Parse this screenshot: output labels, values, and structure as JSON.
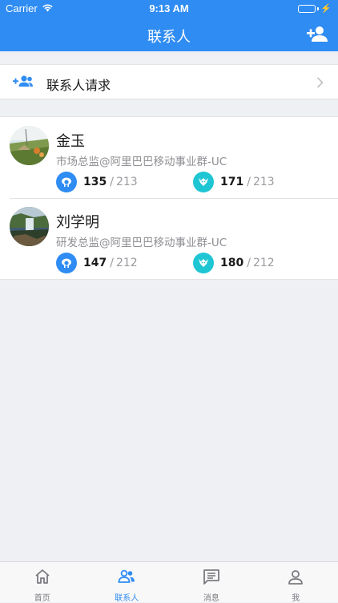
{
  "status": {
    "carrier": "Carrier",
    "time": "9:13 AM",
    "battery_level": 1.0
  },
  "navbar": {
    "title": "联系人",
    "add_icon": "person-add-icon"
  },
  "request_row": {
    "icon": "group-add-icon",
    "label": "联系人请求"
  },
  "contacts": [
    {
      "name": "金玉",
      "title": "市场总监@阿里巴巴移动事业群-UC",
      "stats": [
        {
          "icon": "sheep-icon",
          "color": "#2f8cf3",
          "value": "135",
          "sep": "/",
          "total": "213"
        },
        {
          "icon": "goat-icon",
          "color": "#1ec6d3",
          "value": "171",
          "sep": "/",
          "total": "213"
        }
      ]
    },
    {
      "name": "刘学明",
      "title": "研发总监@阿里巴巴移动事业群-UC",
      "stats": [
        {
          "icon": "sheep-icon",
          "color": "#2f8cf3",
          "value": "147",
          "sep": "/",
          "total": "212"
        },
        {
          "icon": "goat-icon",
          "color": "#1ec6d3",
          "value": "180",
          "sep": "/",
          "total": "212"
        }
      ]
    }
  ],
  "tabs": [
    {
      "icon": "home-icon",
      "label": "首页",
      "active": false
    },
    {
      "icon": "contacts-icon",
      "label": "联系人",
      "active": true
    },
    {
      "icon": "message-icon",
      "label": "消息",
      "active": false
    },
    {
      "icon": "profile-icon",
      "label": "我",
      "active": false
    }
  ],
  "colors": {
    "accent": "#2f8cf3",
    "teal": "#1ec6d3",
    "background": "#eff0f4"
  }
}
